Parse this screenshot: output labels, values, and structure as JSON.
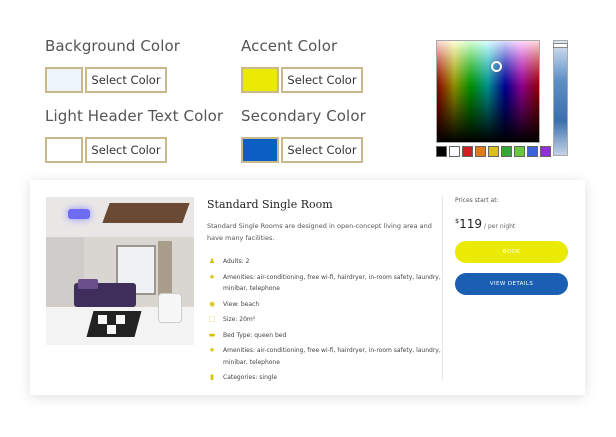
{
  "settings": {
    "background": {
      "label": "Background Color",
      "button": "Select Color",
      "swatch": "#eef5fd"
    },
    "accent": {
      "label": "Accent Color",
      "button": "Select Color",
      "swatch": "#eaea05"
    },
    "light_header": {
      "label": "Light Header Text Color",
      "button": "Select Color",
      "swatch": "#ffffff"
    },
    "secondary": {
      "label": "Secondary Color",
      "button": "Select Color",
      "swatch": "#0b5fc2"
    }
  },
  "picker": {
    "presets": [
      "#000000",
      "#ffffff",
      "#d01f1f",
      "#e07b18",
      "#d8c21a",
      "#35a83a",
      "#6ac83c",
      "#3b62d8",
      "#8f2fd8"
    ]
  },
  "room": {
    "title": "Standard Single Room",
    "description": "Standard Single Rooms are designed in open-concept living area and have many facilities.",
    "amenities": [
      {
        "icon": "person-icon",
        "glyph": "♟",
        "text": "Adults: 2"
      },
      {
        "icon": "star-icon",
        "glyph": "★",
        "text": "Amenities: air-conditioning, free wi-fi, hairdryer, in-room safety, laundry, minibar, telephone"
      },
      {
        "icon": "eye-icon",
        "glyph": "◉",
        "text": "View: beach"
      },
      {
        "icon": "size-icon",
        "glyph": "⬚",
        "text": "Size: 20m²"
      },
      {
        "icon": "bed-icon",
        "glyph": "▬",
        "text": "Bed Type: queen bed"
      },
      {
        "icon": "star-icon",
        "glyph": "★",
        "text": "Amenities: air-conditioning, free wi-fi, hairdryer, in-room safety, laundry, minibar, telephone"
      },
      {
        "icon": "bookmark-icon",
        "glyph": "▮",
        "text": "Categories: single"
      }
    ],
    "price_label": "Prices start at:",
    "currency": "$",
    "price": "119",
    "price_unit": "/ per night",
    "book_label": "BOOK",
    "details_label": "VIEW DETAILS"
  },
  "colors": {
    "border_gold": "#c9b98a",
    "accent": "#eaea05",
    "secondary": "#1a5fb4"
  }
}
